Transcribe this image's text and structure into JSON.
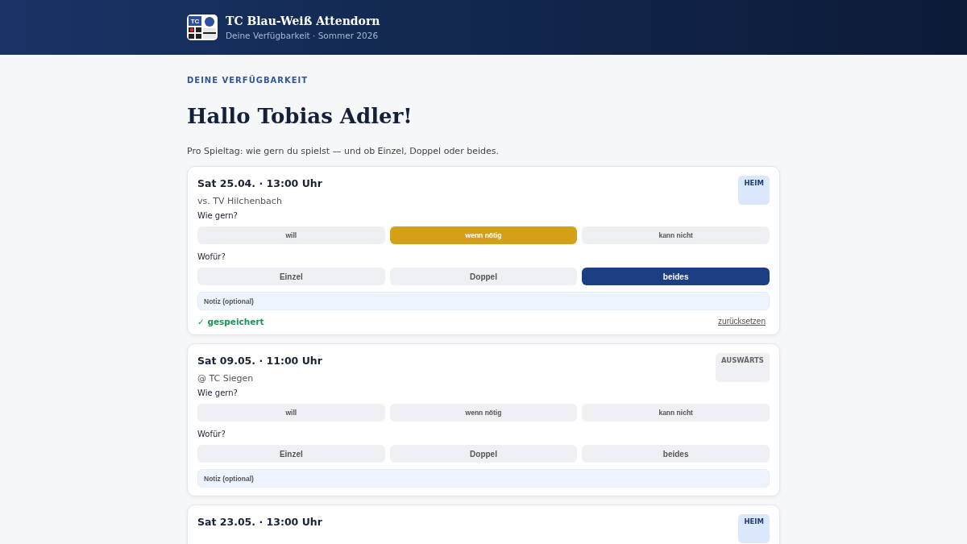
{
  "header": {
    "title": "TC Blau-Weiß Attendorn",
    "subtitle": "Deine Verfügbarkeit · Sommer 2026",
    "logo_text": "TC"
  },
  "eyebrow": "DEINE VERFÜGBARKEIT",
  "heading": "Hallo Tobias Adler!",
  "intro": "Pro Spieltag: wie gern du spielst — und ob Einzel, Doppel oder beides.",
  "matches": [
    {
      "date": "Sat 25.04. · 13:00 Uhr",
      "opponent": "vs. TV Hilchenbach",
      "badge": {
        "kind": "home",
        "label": "HEIM"
      },
      "pref_label": "Wie gern?",
      "prefs": [
        {
          "label": "will",
          "selected": false
        },
        {
          "label": "wenn nötig",
          "selected": true
        },
        {
          "label": "kann nicht",
          "selected": false
        }
      ],
      "type_label": "Wofür?",
      "types": [
        {
          "label": "Einzel",
          "selected": false
        },
        {
          "label": "Doppel",
          "selected": false
        },
        {
          "label": "beides",
          "selected": true
        }
      ],
      "note": {
        "placeholder": "Notiz (optional)"
      },
      "status": "✓ gespeichert",
      "reset": "zurücksetzen"
    },
    {
      "date": "Sat 09.05. · 11:00 Uhr",
      "opponent": "@ TC Siegen",
      "badge": {
        "kind": "away",
        "label": "AUSWÄRTS"
      },
      "pref_label": "Wie gern?",
      "prefs": [
        {
          "label": "will",
          "selected": false
        },
        {
          "label": "wenn nötig",
          "selected": false
        },
        {
          "label": "kann nicht",
          "selected": false
        }
      ],
      "type_label": "Wofür?",
      "types": [
        {
          "label": "Einzel",
          "selected": false
        },
        {
          "label": "Doppel",
          "selected": false
        },
        {
          "label": "beides",
          "selected": false
        }
      ],
      "note": {
        "placeholder": "Notiz (optional)"
      }
    },
    {
      "date": "Sat 23.05. · 13:00 Uhr",
      "badge": {
        "kind": "home",
        "label": "HEIM"
      }
    }
  ]
}
